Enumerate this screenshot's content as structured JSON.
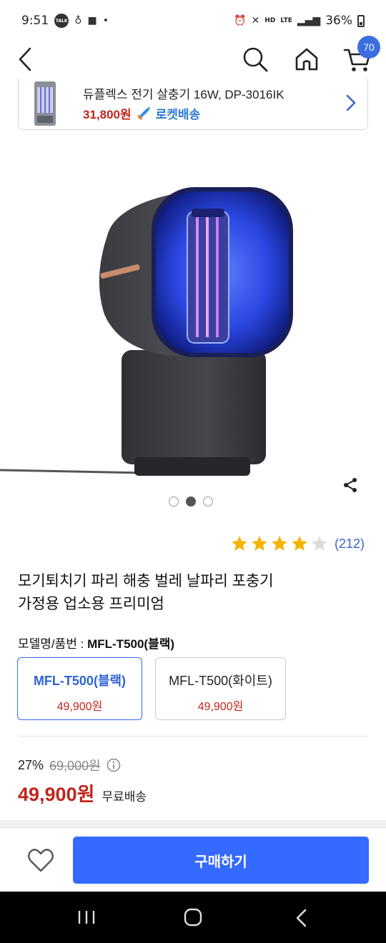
{
  "status_bar": {
    "time": "9:51",
    "battery": "36%",
    "lte": "LTE"
  },
  "nav": {
    "cart_count": "70"
  },
  "related": {
    "name": "듀플렉스 전기 살충기 16W, DP-3016IK",
    "price": "31,800원",
    "delivery": "로켓배송"
  },
  "gallery": {
    "total_images": 3,
    "active_index": 1
  },
  "rating": {
    "stars": 4,
    "max": 5,
    "count": "(212)"
  },
  "product": {
    "title_line1": "모기퇴치기 파리 해충 벌레 날파리 포충기",
    "title_line2": "가정용 업소용 프리미엄"
  },
  "model": {
    "label": "모델명/품번 : ",
    "value": "MFL-T500(블랙)"
  },
  "options": [
    {
      "name": "MFL-T500(블랙)",
      "price": "49,900원",
      "selected": true
    },
    {
      "name": "MFL-T500(화이트)",
      "price": "49,900원",
      "selected": false
    }
  ],
  "pricing": {
    "discount_rate": "27%",
    "original_price": "69,000원",
    "final_price": "49,900원",
    "shipping": "무료배송"
  },
  "bottom": {
    "buy_label": "구매하기"
  },
  "colors": {
    "accent": "#346aff",
    "price_red": "#c0261c",
    "link_blue": "#3a66c9",
    "star_yellow": "#f5b400"
  }
}
